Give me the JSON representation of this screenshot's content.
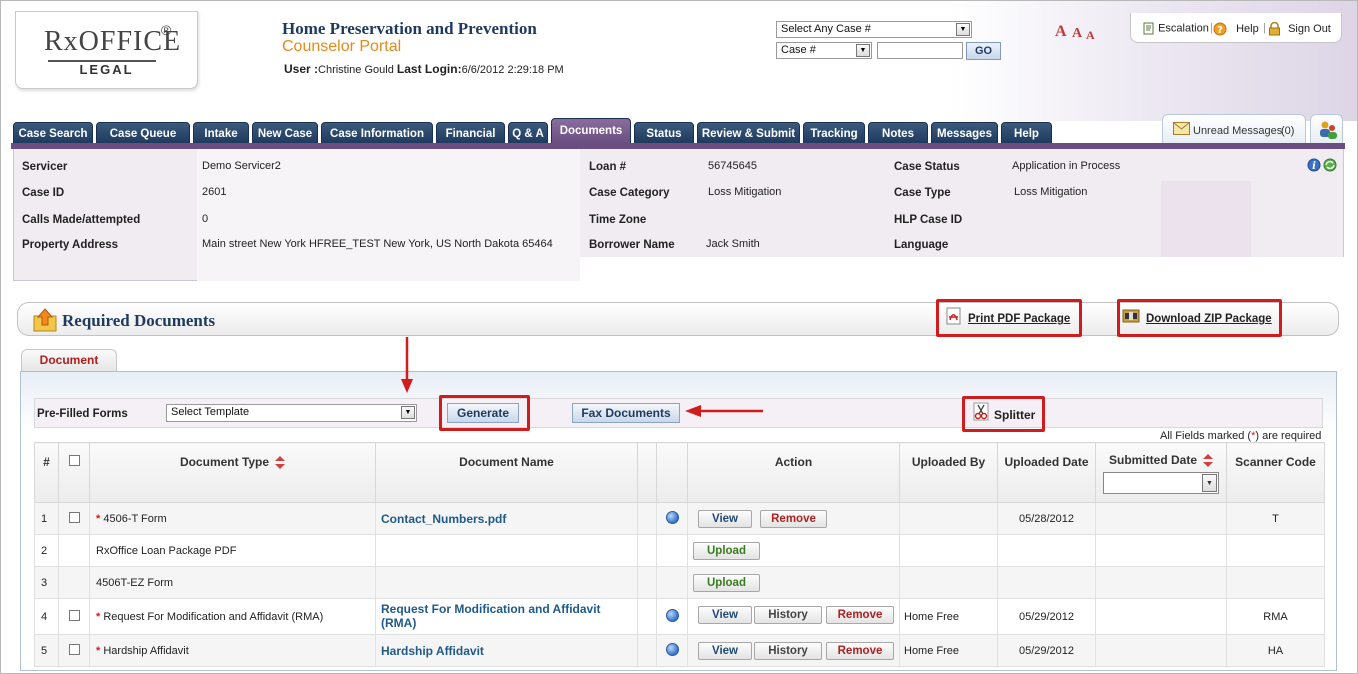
{
  "header": {
    "logo_main": "RxOFFICE",
    "logo_reg": "®",
    "logo_sub": "LEGAL",
    "title": "Home Preservation and Prevention",
    "subtitle": "Counselor Portal",
    "user_label": "User :",
    "user_name": "Christine Gould",
    "last_login_label": "Last Login:",
    "last_login": "6/6/2012 2:29:18 PM",
    "case_select": "Select Any Case #",
    "case_type_select": "Case #",
    "go_label": "GO",
    "font_letters": [
      "A",
      "A",
      "A"
    ],
    "escalation": "Escalation",
    "help": "Help",
    "sign_out": "Sign Out",
    "unread_messages": "Unread Messages",
    "unread_count": "(0)"
  },
  "tabs": [
    {
      "label": "Case Search"
    },
    {
      "label": "Case Queue"
    },
    {
      "label": "Intake"
    },
    {
      "label": "New Case"
    },
    {
      "label": "Case Information"
    },
    {
      "label": "Financial"
    },
    {
      "label": "Q & A"
    },
    {
      "label": "Documents",
      "active": true
    },
    {
      "label": "Status"
    },
    {
      "label": "Review & Submit"
    },
    {
      "label": "Tracking"
    },
    {
      "label": "Notes"
    },
    {
      "label": "Messages"
    },
    {
      "label": "Help"
    }
  ],
  "info": {
    "servicer_label": "Servicer",
    "servicer": "Demo Servicer2",
    "case_id_label": "Case ID",
    "case_id": "2601",
    "calls_label": "Calls Made/attempted",
    "calls": "0",
    "address_label": "Property Address",
    "address": "Main street New York HFREE_TEST  New York, US North Dakota 65464",
    "loan_label": "Loan #",
    "loan": "56745645",
    "category_label": "Case Category",
    "category": "Loss Mitigation",
    "timezone_label": "Time Zone",
    "timezone": "",
    "borrower_label": "Borrower Name",
    "borrower": "Jack Smith",
    "status_label": "Case Status",
    "status": "Application in Process",
    "type_label": "Case Type",
    "type": "Loss Mitigation",
    "hlp_label": "HLP Case ID",
    "hlp": "",
    "language_label": "Language",
    "language": ""
  },
  "required": {
    "title": "Required Documents",
    "print_pdf": "Print PDF Package",
    "download_zip": "Download ZIP Package",
    "doc_tab": "Document",
    "prefilled_label": "Pre-Filled Forms",
    "template_select": "Select Template",
    "generate": "Generate",
    "fax": "Fax Documents",
    "splitter": "Splitter",
    "required_hint_pre": "All Fields marked (",
    "required_hint_star": "*",
    "required_hint_post": ") are required"
  },
  "table": {
    "headers": [
      "#",
      "",
      "Document Type",
      "Document Name",
      "",
      "",
      "Action",
      "Uploaded By",
      "Uploaded Date",
      "Submitted Date",
      "Scanner Code"
    ],
    "rows": [
      {
        "num": "1",
        "check": true,
        "required": true,
        "type": "4506-T Form",
        "name": "Contact_Numbers.pdf",
        "globe": true,
        "actions": [
          "View",
          "Remove"
        ],
        "by": "",
        "date": "05/28/2012",
        "code": "T"
      },
      {
        "num": "2",
        "check": false,
        "required": false,
        "type": "RxOffice Loan Package PDF",
        "name": "",
        "globe": false,
        "actions": [
          "Upload"
        ],
        "by": "",
        "date": "",
        "code": ""
      },
      {
        "num": "3",
        "check": false,
        "required": false,
        "type": "4506T-EZ Form",
        "name": "",
        "globe": false,
        "actions": [
          "Upload"
        ],
        "by": "",
        "date": "",
        "code": ""
      },
      {
        "num": "4",
        "check": true,
        "required": true,
        "type": "Request For Modification and Affidavit (RMA)",
        "name": "Request For Modification and Affidavit (RMA)",
        "globe": true,
        "actions": [
          "View",
          "History",
          "Remove"
        ],
        "by": "Home Free",
        "date": "05/29/2012",
        "code": "RMA"
      },
      {
        "num": "5",
        "check": true,
        "required": true,
        "type": "Hardship Affidavit",
        "name": "Hardship Affidavit",
        "globe": true,
        "actions": [
          "View",
          "History",
          "Remove"
        ],
        "by": "Home Free",
        "date": "05/29/2012",
        "code": "HA"
      }
    ]
  },
  "colors": {
    "navy": "#1f3a5f",
    "active_tab": "#6b4e81",
    "orange": "#e8891b",
    "red": "#d01c1c"
  }
}
